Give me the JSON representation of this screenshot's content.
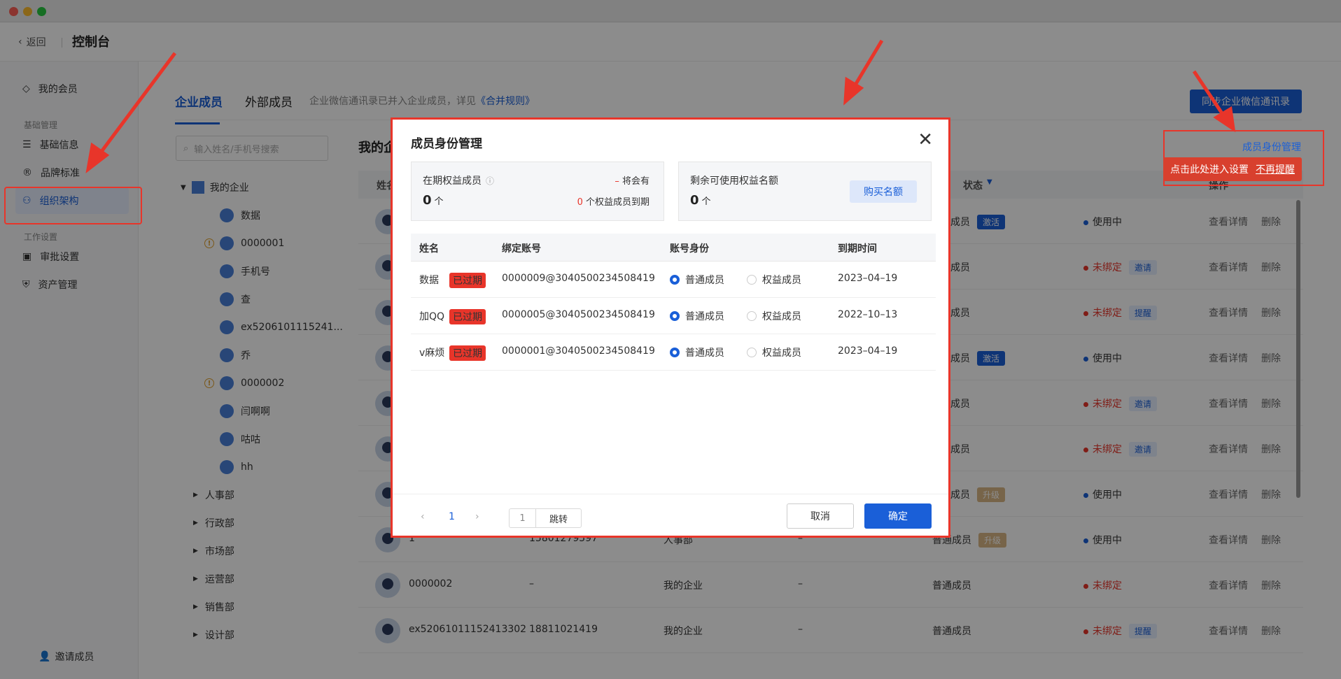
{
  "app": {
    "back_label": "返回",
    "title": "控制台"
  },
  "sidebar": {
    "items": [
      {
        "label": "我的会员"
      },
      {
        "label": "基础信息"
      },
      {
        "label": "品牌标准"
      },
      {
        "label": "组织架构"
      },
      {
        "label": "审批设置"
      },
      {
        "label": "资产管理"
      }
    ],
    "groups": [
      "基础管理",
      "工作设置"
    ],
    "invite_label": "邀请成员"
  },
  "tabs": [
    {
      "label": "企业成员"
    },
    {
      "label": "外部成员"
    }
  ],
  "tab_note": {
    "text": "企业微信通讯录已并入企业成员，详见",
    "link": "《合并规则》"
  },
  "top_button": "同步企业微信通讯录",
  "search": {
    "placeholder": "输入姓名/手机号搜索"
  },
  "tree": {
    "root": "我的企业",
    "children": [
      "数据",
      "0000001",
      "手机号",
      "查",
      "ex5206101115241...",
      "乔",
      "0000002",
      "闫啊啊",
      "咕咕",
      "hh"
    ],
    "depts": [
      "人事部",
      "行政部",
      "市场部",
      "运营部",
      "销售部",
      "设计部"
    ]
  },
  "main": {
    "title": "我的企",
    "headers": {
      "name": "姓名",
      "status": "状态",
      "op": "操作"
    },
    "rows": [
      {
        "role": "成员",
        "badge": "激活",
        "status": "使用中"
      },
      {
        "role": "成员",
        "badge": "",
        "status": "未绑定",
        "sbadge": "邀请"
      },
      {
        "role": "成员",
        "badge": "",
        "status": "未绑定",
        "sbadge": "提醒"
      },
      {
        "role": "成员",
        "badge": "激活",
        "status": "使用中"
      },
      {
        "role": "成员",
        "badge": "",
        "status": "未绑定",
        "sbadge": "邀请"
      },
      {
        "role": "成员",
        "badge": "",
        "status": "未绑定",
        "sbadge": "邀请"
      },
      {
        "role": "成员",
        "badge": "升级",
        "status": "使用中"
      },
      {
        "name": "1",
        "phone": "15801279597",
        "dept": "人事部",
        "due": "–",
        "role": "普通成员",
        "badge": "升级",
        "status": "使用中"
      },
      {
        "name": "0000002",
        "phone": "–",
        "dept": "我的企业",
        "due": "–",
        "role": "普通成员",
        "badge": "",
        "status": "未绑定"
      },
      {
        "name": "ex52061011152413302",
        "phone": "18811021419",
        "dept": "我的企业",
        "due": "–",
        "role": "普通成员",
        "badge": "",
        "status": "未绑定",
        "sbadge": "提醒"
      }
    ],
    "op_view": "查看详情",
    "op_delete": "删除"
  },
  "hint": {
    "link": "成员身份管理",
    "tip": "点击此处进入设置",
    "dismiss": "不再提醒"
  },
  "dialog": {
    "title": "成员身份管理",
    "card1": {
      "label": "在期权益成员",
      "count": "0",
      "unit": "个",
      "soon_prefix": "–",
      "soon_label": "将会有",
      "expire_count": "0",
      "expire_label": "个权益成员到期"
    },
    "card2": {
      "label": "剩余可使用权益名额",
      "count": "0",
      "unit": "个",
      "buy": "购买名额"
    },
    "columns": [
      "姓名",
      "绑定账号",
      "账号身份",
      "到期时间"
    ],
    "rows": [
      {
        "name": "数据",
        "tag": "已过期",
        "account": "0000009@3040500234508419",
        "opt1": "普通成员",
        "opt2": "权益成员",
        "date": "2023–04–19"
      },
      {
        "name": "加QQ",
        "tag": "已过期",
        "account": "0000005@3040500234508419",
        "opt1": "普通成员",
        "opt2": "权益成员",
        "date": "2022–10–13"
      },
      {
        "name": "v麻烦",
        "tag": "已过期",
        "account": "0000001@3040500234508419",
        "opt1": "普通成员",
        "opt2": "权益成员",
        "date": "2023–04–19"
      }
    ],
    "page": "1",
    "jump_value": "1",
    "jump_label": "跳转",
    "cancel": "取消",
    "confirm": "确定"
  }
}
